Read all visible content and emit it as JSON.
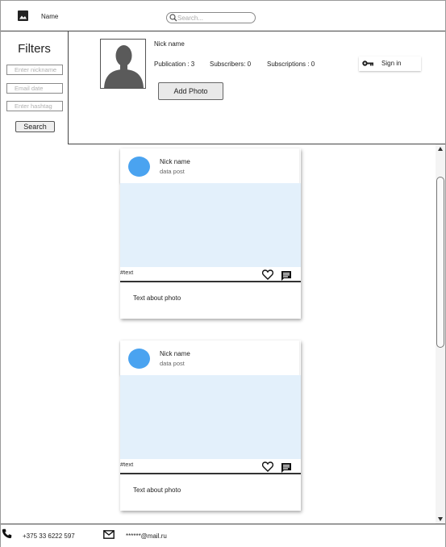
{
  "header": {
    "app_name": "Name",
    "logo_icon": "image-icon",
    "search": {
      "placeholder": "Search...",
      "value": "",
      "icon": "search-icon"
    }
  },
  "filters": {
    "title": "Filters",
    "nickname_placeholder": "Enter nickname",
    "email_placeholder": "Email date",
    "hashtag_placeholder": "Enter hashtag",
    "search_label": "Search"
  },
  "profile": {
    "nick_name": "Nick name",
    "publication": "Publication  : 3",
    "subscribers": "Subscribers: 0",
    "subscriptions": "Subscriptions  : 0",
    "add_photo_label": "Add Photo",
    "sign_in_label": "Sign in",
    "sign_in_icon": "key-icon",
    "avatar_icon": "user-silhouette-icon"
  },
  "posts": [
    {
      "nick": "Nick name",
      "date": "data post",
      "tags": "#text",
      "caption": "Text about photo",
      "avatar_color": "#4aa3f0",
      "photo_color": "#e3f0fb"
    },
    {
      "nick": "Nick name",
      "date": "data post",
      "tags": "#text",
      "caption": "Text about photo",
      "avatar_color": "#4aa3f0",
      "photo_color": "#e3f0fb"
    }
  ],
  "footer": {
    "phone": "+375 33 6222 597",
    "email": "******@mail.ru",
    "phone_icon": "phone-icon",
    "mail_icon": "mail-icon"
  }
}
